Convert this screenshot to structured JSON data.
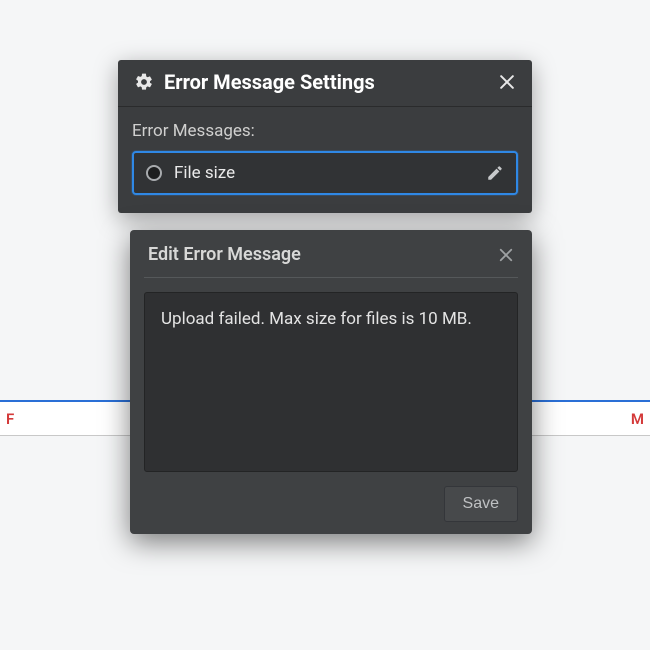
{
  "bg_strip": {
    "left_char": "F",
    "right_char": "M"
  },
  "panel": {
    "title": "Error Message Settings",
    "section_label": "Error Messages:",
    "items": [
      {
        "label": "File size",
        "selected": true
      }
    ]
  },
  "editor": {
    "title": "Edit Error Message",
    "value": "Upload failed. Max size for files is 10 MB.",
    "save_label": "Save"
  }
}
